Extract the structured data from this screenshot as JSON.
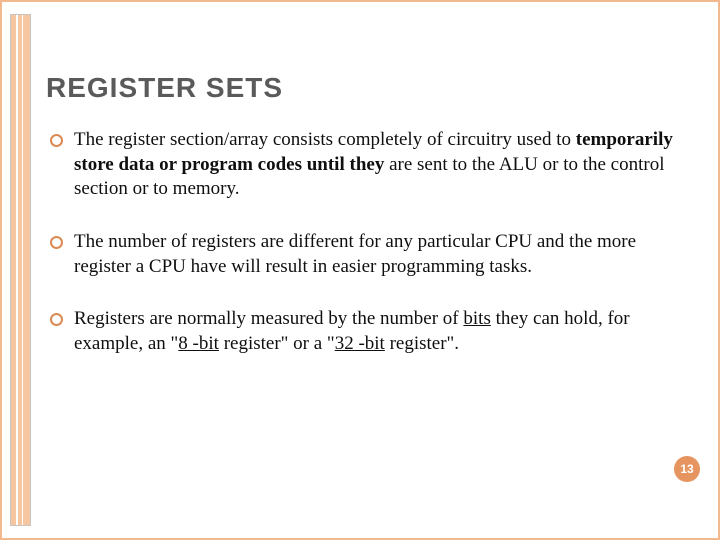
{
  "title": "REGISTER SETS",
  "bullets": [
    {
      "plain1": "The register section/array consists completely of circuitry used to ",
      "bold": "temporarily store data or program codes until they",
      "plain2": " are sent to the ALU or to the control section or to memory."
    },
    {
      "plain1": "The number of registers are different for any particular CPU and the more register a CPU have will result in easier programming tasks.",
      "bold": "",
      "plain2": ""
    },
    {
      "plain1": "Registers are normally measured by the number of ",
      "ul1": "bits",
      "plain2": " they can hold, for example, an \"",
      "ul2": "8 -bit",
      "plain3": " register\" or a \"",
      "ul3": "32 -bit",
      "plain4": " register\"."
    }
  ],
  "page_number": "13"
}
